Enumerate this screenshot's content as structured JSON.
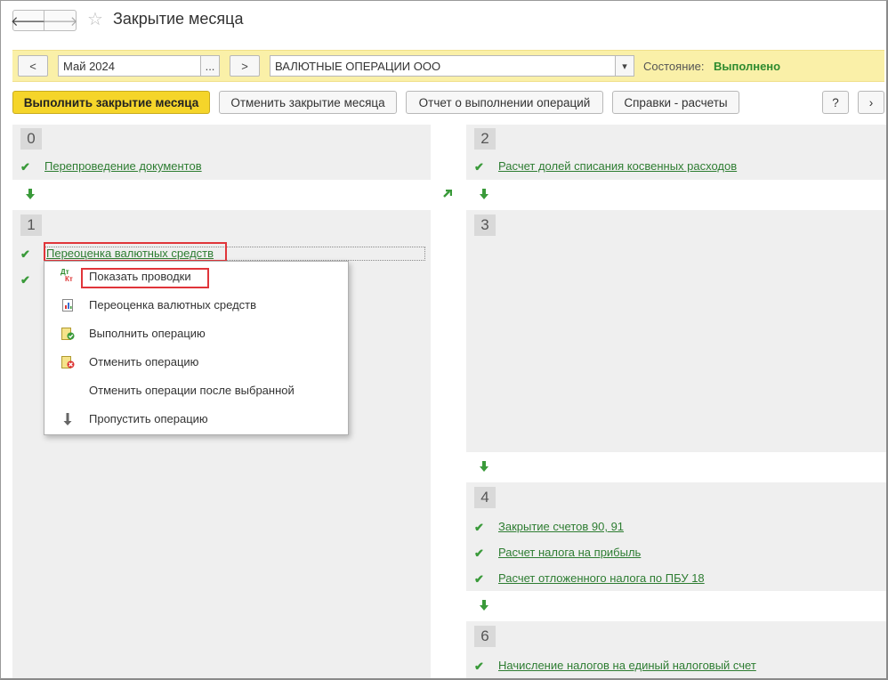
{
  "window": {
    "title": "Закрытие месяца"
  },
  "nav": {
    "back_glyph": "🡐",
    "forward_glyph": "🡒",
    "favorite_glyph": "☆"
  },
  "period": {
    "prev_label": "<",
    "value": "Май 2024",
    "picker_label": "...",
    "next_label": ">"
  },
  "organization": {
    "value": "ВАЛЮТНЫЕ ОПЕРАЦИИ ООО",
    "dropdown_glyph": "▾"
  },
  "status": {
    "label": "Состояние:",
    "value": "Выполнено",
    "color": "#2e8b2e"
  },
  "toolbar": {
    "run_label": "Выполнить закрытие месяца",
    "cancel_label": "Отменить закрытие месяца",
    "report_label": "Отчет о выполнении операций",
    "calc_label": "Справки - расчеты",
    "help_label": "?",
    "more_label": "›"
  },
  "steps": {
    "s0": {
      "num": "0",
      "ops": [
        "Перепроведение документов"
      ]
    },
    "s1": {
      "num": "1",
      "ops": [
        "Переоценка валютных средств"
      ]
    },
    "s2": {
      "num": "2",
      "ops": [
        "Расчет долей списания косвенных расходов"
      ]
    },
    "s3": {
      "num": "3",
      "ops": []
    },
    "s4": {
      "num": "4",
      "ops": [
        "Закрытие счетов 90, 91",
        "Расчет налога на прибыль",
        "Расчет отложенного налога по ПБУ 18"
      ]
    },
    "s6": {
      "num": "6",
      "ops": [
        "Начисление налогов на единый налоговый счет"
      ]
    }
  },
  "context_menu": {
    "items": [
      {
        "label": "Показать проводки",
        "icon": "dt-kt-icon"
      },
      {
        "label": "Переоценка валютных средств",
        "icon": "report-icon"
      },
      {
        "label": "Выполнить операцию",
        "icon": "execute-icon"
      },
      {
        "label": "Отменить операцию",
        "icon": "cancel-operation-icon"
      },
      {
        "label": "Отменить операции после выбранной",
        "icon": ""
      },
      {
        "label": "Пропустить операцию",
        "icon": "skip-arrow-icon"
      }
    ],
    "dtkt": {
      "top": "Дт",
      "bottom": "Кт"
    }
  },
  "colors": {
    "accent_green": "#3a9a3a",
    "link_green": "#2e7d32",
    "highlight_red": "#e0353a",
    "primary_yellow": "#f5d52a"
  }
}
